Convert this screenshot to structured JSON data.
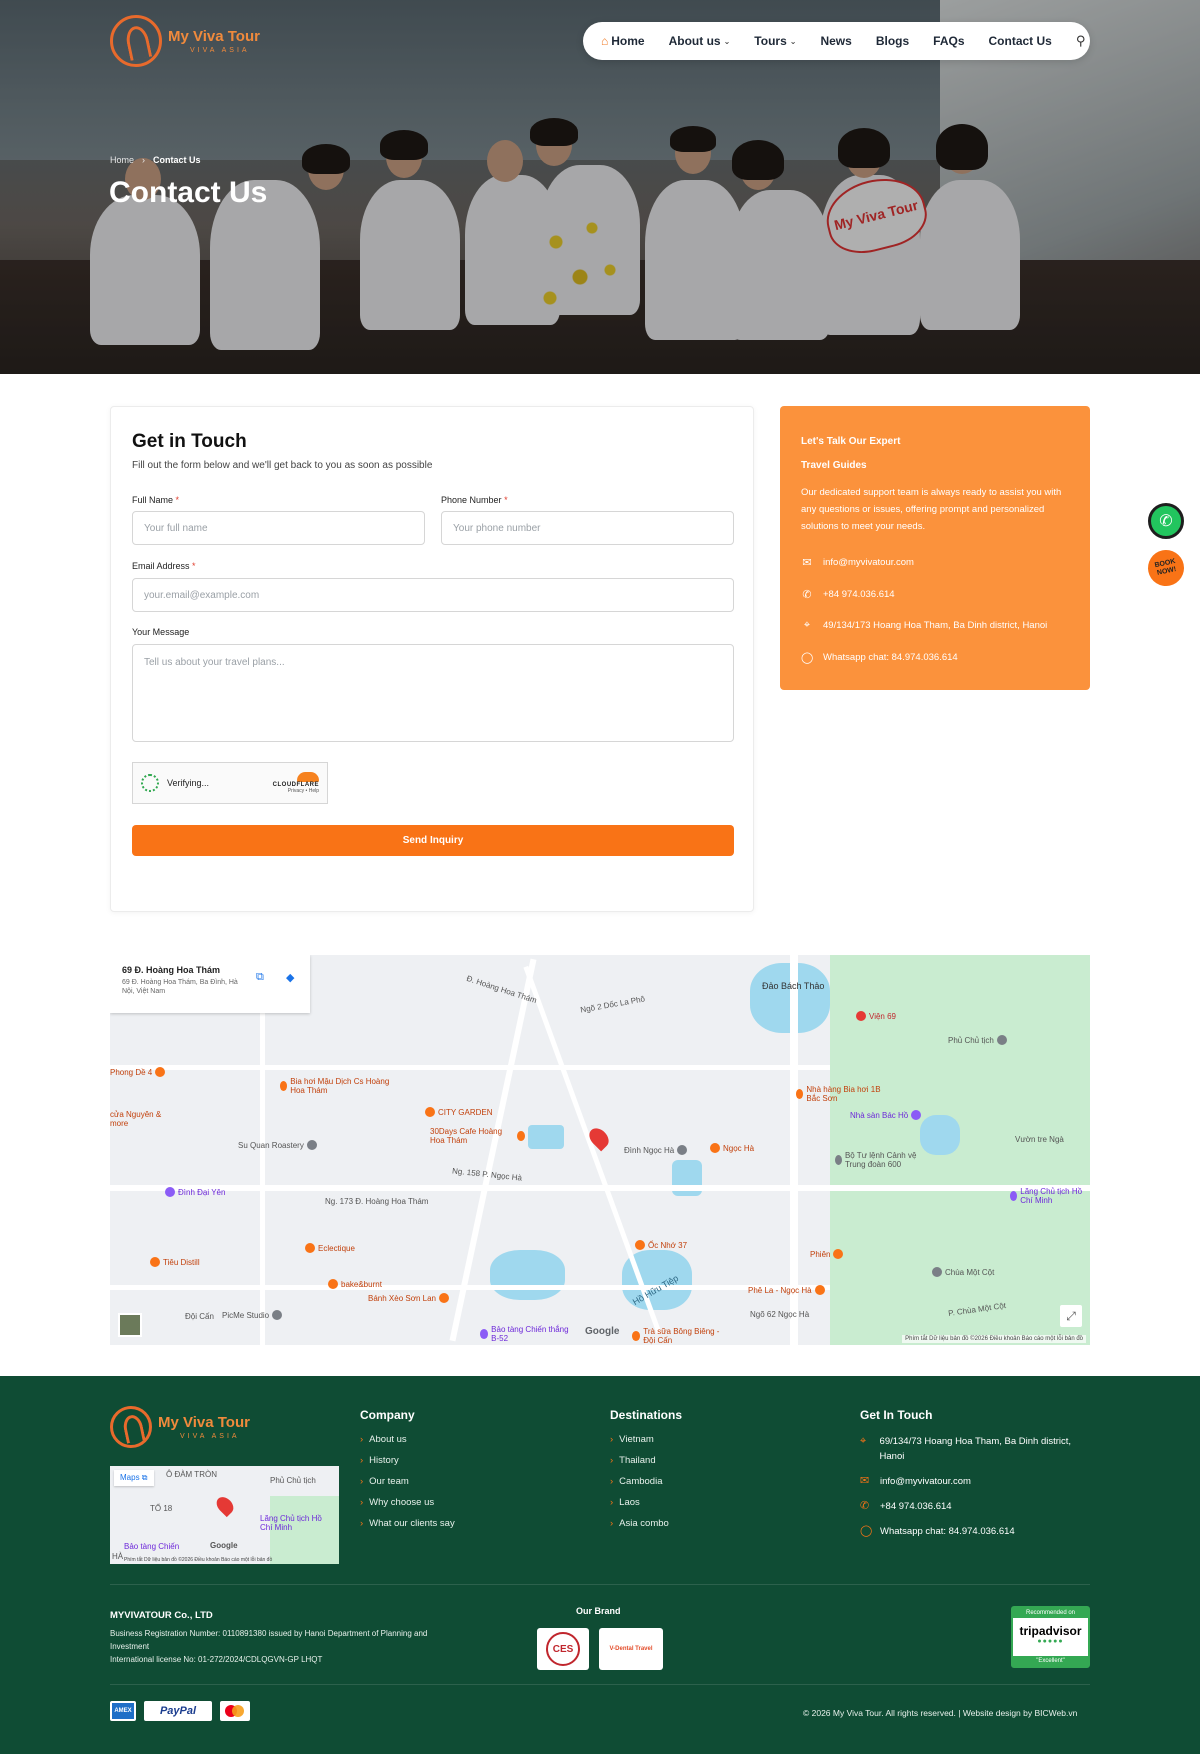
{
  "brand": {
    "name": "My Viva Tour",
    "tagline": "VIVA ASIA"
  },
  "nav": {
    "items": [
      {
        "label": "Home",
        "dropdown": false
      },
      {
        "label": "About us",
        "dropdown": true
      },
      {
        "label": "Tours",
        "dropdown": true
      },
      {
        "label": "News",
        "dropdown": false
      },
      {
        "label": "Blogs",
        "dropdown": false
      },
      {
        "label": "FAQs",
        "dropdown": false
      },
      {
        "label": "Contact Us",
        "dropdown": false
      }
    ]
  },
  "hero": {
    "breadcrumb": {
      "home": "Home",
      "current": "Contact Us"
    },
    "title": "Contact Us",
    "sign_text": "My Viva Tour"
  },
  "form": {
    "title": "Get in Touch",
    "subtitle": "Fill out the form below and we'll get back to you as soon as possible",
    "full_name": {
      "label": "Full Name",
      "required": "*",
      "placeholder": "Your full name"
    },
    "phone": {
      "label": "Phone Number",
      "required": "*",
      "placeholder": "Your phone number"
    },
    "email": {
      "label": "Email Address",
      "required": "*",
      "placeholder": "your.email@example.com"
    },
    "message": {
      "label": "Your Message",
      "placeholder": "Tell us about your travel plans..."
    },
    "captcha": {
      "status": "Verifying...",
      "provider": "CLOUDFLARE",
      "links": "Privacy • Help"
    },
    "submit": "Send Inquiry"
  },
  "info": {
    "heading_line1": "Let's Talk Our Expert",
    "heading_line2": "Travel Guides",
    "description": "Our dedicated support team is always ready to assist you with any questions or issues, offering prompt and personalized solutions to meet your needs.",
    "email": "info@myvivatour.com",
    "phone": "+84 974.036.614",
    "address": "49/134/173 Hoang Hoa Tham, Ba Dinh district, Hanoi",
    "whatsapp": "Whatsapp chat:  84.974.036.614"
  },
  "floating": {
    "whatsapp_icon": "whatsapp-icon",
    "book_now": "BOOK NOW!"
  },
  "map": {
    "place_name": "69 Đ. Hoàng Hoa Thám",
    "place_address": "69 Đ. Hoàng Hoa Thám, Ba Đình, Hà Nội, Việt Nam",
    "labels": [
      {
        "text": "Đ. Hoàng Hoa Thám",
        "cls": "lbl"
      },
      {
        "text": "Ngõ 2 Dốc La Phô",
        "cls": "lbl"
      },
      {
        "text": "Đảo Bách Thảo",
        "cls": "lbl"
      },
      {
        "text": "Viện 69",
        "cls": "poi"
      },
      {
        "text": "Phủ Chủ tịch",
        "cls": "poi gray"
      },
      {
        "text": "Phong Dề 4",
        "cls": "poi"
      },
      {
        "text": "Bia hơi Mậu Dịch Cs Hoàng Hoa Thám",
        "cls": "poi"
      },
      {
        "text": "Nhà hàng Bia hơi 1B Bắc Sơn",
        "cls": "poi"
      },
      {
        "text": "Nhà sàn Bác Hồ",
        "cls": "poi purple"
      },
      {
        "text": "cửa Nguyên & more",
        "cls": "poi"
      },
      {
        "text": "CITY GARDEN",
        "cls": "poi"
      },
      {
        "text": "Su Quan Roastery",
        "cls": "poi gray"
      },
      {
        "text": "30Days Cafe Hoàng Hoa Thám",
        "cls": "poi"
      },
      {
        "text": "Đình Ngọc Hà",
        "cls": "poi gray"
      },
      {
        "text": "Ngọc Hà",
        "cls": "poi"
      },
      {
        "text": "Bộ Tư lệnh Cảnh vệ Trung đoàn 600",
        "cls": "poi gray"
      },
      {
        "text": "Vườn tre Ngà",
        "cls": "lbl"
      },
      {
        "text": "Ng. 158 P. Ngọc Hà",
        "cls": "lbl"
      },
      {
        "text": "Đình Đại Yên",
        "cls": "poi purple"
      },
      {
        "text": "Ng. 173 Đ. Hoàng Hoa Thám",
        "cls": "lbl"
      },
      {
        "text": "Lăng Chủ tịch Hồ Chí Minh",
        "cls": "poi purple"
      },
      {
        "text": "Eclectique",
        "cls": "poi"
      },
      {
        "text": "Ốc Nhớ 37",
        "cls": "poi"
      },
      {
        "text": "Tiêu Distill",
        "cls": "poi"
      },
      {
        "text": "Phiên",
        "cls": "poi"
      },
      {
        "text": "Chùa Một Cột",
        "cls": "poi gray"
      },
      {
        "text": "bake&burnt",
        "cls": "poi"
      },
      {
        "text": "Bánh Xèo Sơn Lan",
        "cls": "poi"
      },
      {
        "text": "Hồ Hữu Tiệp",
        "cls": "lbl"
      },
      {
        "text": "Phê La - Ngọc Hà",
        "cls": "poi"
      },
      {
        "text": "Đội Cấn",
        "cls": "lbl"
      },
      {
        "text": "PicMe Studio",
        "cls": "poi gray"
      },
      {
        "text": "Bảo tàng Chiến thắng B-52",
        "cls": "poi purple"
      },
      {
        "text": "Trà sữa Bông Biêng - Đội Cấn",
        "cls": "poi"
      },
      {
        "text": "Ngõ 62 Ngọc Hà",
        "cls": "lbl"
      },
      {
        "text": "P. Chùa Một Cột",
        "cls": "lbl"
      }
    ],
    "attribution": "Phím tắt   Dữ liệu bản đồ ©2026   Điều khoản   Báo cáo một lỗi bản đồ",
    "google": "Google"
  },
  "footer": {
    "mini_map": {
      "maps_label": "Maps",
      "labels": [
        "Ô ĐÀM TRÒN",
        "Phủ Chủ tịch",
        "TỔ 18",
        "Lăng Chủ tịch Hồ Chí Minh",
        "Bảo tàng Chiến",
        "Google",
        "HÀ"
      ],
      "attribution": "Phím tắt   Dữ liệu bản đồ ©2026   Điều khoản   Báo cáo một lỗi bản đồ"
    },
    "company": {
      "title": "Company",
      "links": [
        "About us",
        "History",
        "Our team",
        "Why choose us",
        "What our clients say"
      ]
    },
    "destinations": {
      "title": "Destinations",
      "links": [
        "Vietnam",
        "Thailand",
        "Cambodia",
        "Laos",
        "Asia combo"
      ]
    },
    "contact": {
      "title": "Get In Touch",
      "address": "69/134/73 Hoang Hoa Tham, Ba Dinh district, Hanoi",
      "email": "info@myvivatour.com",
      "phone": "+84 974.036.614",
      "whatsapp": "Whatsapp chat: 84.974.036.614"
    },
    "legal": {
      "name": "MYVIVATOUR Co., LTD",
      "line1": "Business Registration Number: 0110891380 issued by Hanoi Department of Planning and Investment",
      "line2": "International license No: 01-272/2024/CDLQGVN-GP LHQT"
    },
    "our_brand": "Our Brand",
    "brands": [
      "CES",
      "V-Dental Travel"
    ],
    "tripadvisor": {
      "top": "Recommended on",
      "name": "tripadvisor",
      "badge": "\"Excellent\""
    },
    "payments": [
      "AMEX",
      "PayPal",
      "Mastercard"
    ],
    "copyright": "© 2026 My Viva Tour. All rights reserved. | Website design by BICWeb.vn"
  }
}
